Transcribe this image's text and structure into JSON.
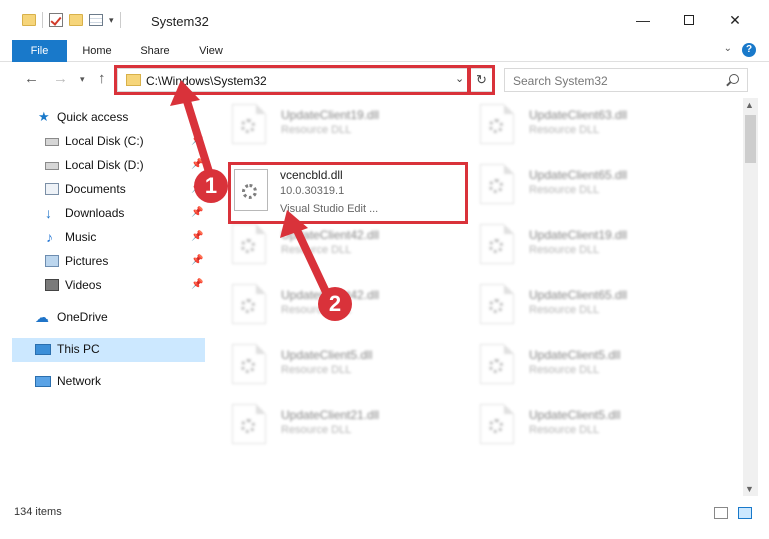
{
  "window": {
    "title": "System32",
    "minimize_icon": "minimize-icon",
    "maximize_icon": "maximize-icon",
    "close_icon": "close-icon"
  },
  "ribbon": {
    "tabs": [
      "File",
      "Home",
      "Share",
      "View"
    ],
    "help": "?"
  },
  "address": {
    "path": "C:\\Windows\\System32",
    "refresh_icon": "refresh-icon",
    "dropdown_icon": "chevron-down-icon"
  },
  "search": {
    "placeholder": "Search System32"
  },
  "sidebar": {
    "quick_access": "Quick access",
    "items": [
      {
        "label": "Local Disk (C:)",
        "icon": "drive-icon",
        "pinned": true
      },
      {
        "label": "Local Disk (D:)",
        "icon": "drive-icon",
        "pinned": true
      },
      {
        "label": "Documents",
        "icon": "documents-icon",
        "pinned": true
      },
      {
        "label": "Downloads",
        "icon": "downloads-icon",
        "pinned": true
      },
      {
        "label": "Music",
        "icon": "music-icon",
        "pinned": true
      },
      {
        "label": "Pictures",
        "icon": "pictures-icon",
        "pinned": true
      },
      {
        "label": "Videos",
        "icon": "videos-icon",
        "pinned": true
      }
    ],
    "onedrive": "OneDrive",
    "this_pc": "This PC",
    "network": "Network"
  },
  "files": {
    "left": [
      {
        "name": "UpdateClient19.dll",
        "type": "Resource DLL"
      },
      {
        "name": "UpdateClient42.dll",
        "type": "Resource DLL"
      },
      {
        "name": "UpdateClient42.dll",
        "type": "Resource DLL"
      },
      {
        "name": "UpdateClient5.dll",
        "type": "Resource DLL"
      },
      {
        "name": "UpdateClient21.dll",
        "type": "Resource DLL"
      }
    ],
    "right": [
      {
        "name": "UpdateClient63.dll",
        "type": "Resource DLL"
      },
      {
        "name": "UpdateClient65.dll",
        "type": "Resource DLL"
      },
      {
        "name": "UpdateClient19.dll",
        "type": "Resource DLL"
      },
      {
        "name": "UpdateClient65.dll",
        "type": "Resource DLL"
      },
      {
        "name": "UpdateClient5.dll",
        "type": "Resource DLL"
      },
      {
        "name": "UpdateClient5.dll",
        "type": "Resource DLL"
      }
    ],
    "highlighted": {
      "name": "vcencbld.dll",
      "version": "10.0.30319.1",
      "description": "Visual Studio Edit ..."
    }
  },
  "annotations": {
    "step1": "1",
    "step2": "2",
    "color": "#d9323a"
  },
  "status": {
    "item_count": "134 items"
  }
}
